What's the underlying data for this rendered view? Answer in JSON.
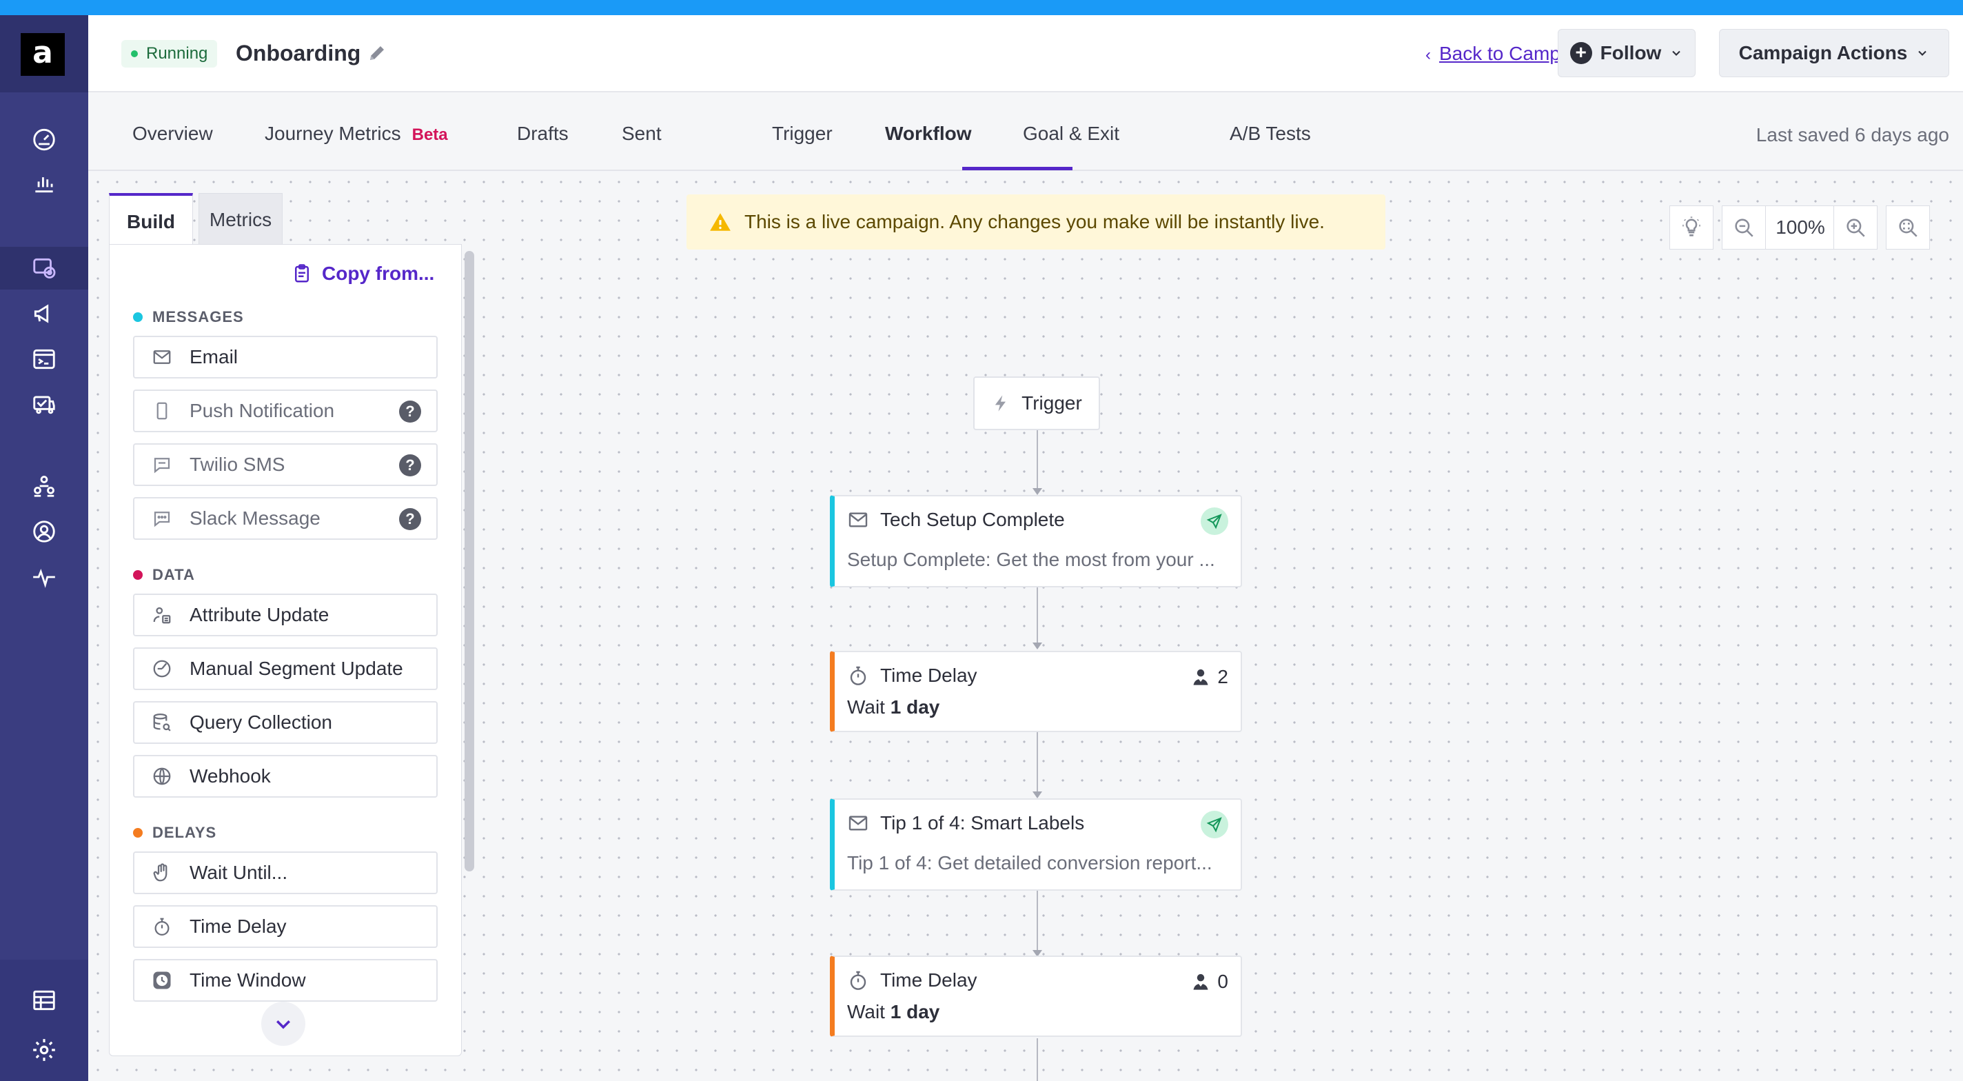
{
  "header": {
    "status": "Running",
    "campaign_name": "Onboarding",
    "back_link": "Back to Campaigns",
    "follow_label": "Follow",
    "actions_label": "Campaign Actions"
  },
  "sidebar": {
    "logo_text": "a",
    "icons": [
      "dashboard-icon",
      "analytics-icon",
      "campaigns-icon",
      "broadcasts-icon",
      "api-triggered-icon",
      "transactional-icon",
      "segments-icon",
      "people-icon",
      "activity-icon",
      "content-icon",
      "settings-icon"
    ]
  },
  "tabs": {
    "items": [
      {
        "label": "Overview"
      },
      {
        "label": "Journey Metrics",
        "badge": "Beta"
      },
      {
        "label": "Drafts"
      },
      {
        "label": "Sent"
      },
      {
        "label": "Trigger"
      },
      {
        "label": "Workflow",
        "active": true
      },
      {
        "label": "Goal & Exit"
      },
      {
        "label": "A/B Tests"
      }
    ],
    "last_saved": "Last saved 6 days ago"
  },
  "builder": {
    "tabs": [
      {
        "label": "Build",
        "active": true
      },
      {
        "label": "Metrics"
      }
    ],
    "copy_from": "Copy from...",
    "sections": [
      {
        "label": "MESSAGES",
        "color": "#1bc6e0",
        "items": [
          {
            "label": "Email",
            "icon": "envelope-icon"
          },
          {
            "label": "Push Notification",
            "icon": "mobile-icon",
            "help": "?"
          },
          {
            "label": "Twilio SMS",
            "icon": "chat-bubble-icon",
            "help": "?"
          },
          {
            "label": "Slack Message",
            "icon": "chat-dots-icon",
            "help": "?"
          }
        ]
      },
      {
        "label": "DATA",
        "color": "#d3145a",
        "items": [
          {
            "label": "Attribute Update",
            "icon": "person-attribute-icon"
          },
          {
            "label": "Manual Segment Update",
            "icon": "segment-pie-icon"
          },
          {
            "label": "Query Collection",
            "icon": "database-search-icon"
          },
          {
            "label": "Webhook",
            "icon": "globe-icon"
          }
        ]
      },
      {
        "label": "DELAYS",
        "color": "#f47c20",
        "items": [
          {
            "label": "Wait Until...",
            "icon": "hand-icon"
          },
          {
            "label": "Time Delay",
            "icon": "stopwatch-icon"
          },
          {
            "label": "Time Window",
            "icon": "clock-icon"
          }
        ]
      }
    ]
  },
  "banner": {
    "text": "This is a live campaign. Any changes you make will be instantly live."
  },
  "zoom": {
    "level": "100%"
  },
  "workflow": {
    "trigger_label": "Trigger",
    "nodes": [
      {
        "type": "message",
        "title": "Tech Setup Complete",
        "subtitle": "Setup Complete: Get the most from your ..."
      },
      {
        "type": "delay",
        "title": "Time Delay",
        "prefix": "Wait ",
        "value": "1 day",
        "count": "2"
      },
      {
        "type": "message",
        "title": "Tip 1 of 4: Smart Labels",
        "subtitle": "Tip 1 of 4: Get detailed conversion report..."
      },
      {
        "type": "delay",
        "title": "Time Delay",
        "prefix": "Wait ",
        "value": "1 day",
        "count": "0"
      }
    ]
  },
  "colors": {
    "accent": "#5527c9",
    "sidebar": "#3a3d80",
    "message_accent": "#1bc6e0",
    "delay_accent": "#f47c20",
    "data_accent": "#d3145a",
    "running": "#22c06a"
  }
}
